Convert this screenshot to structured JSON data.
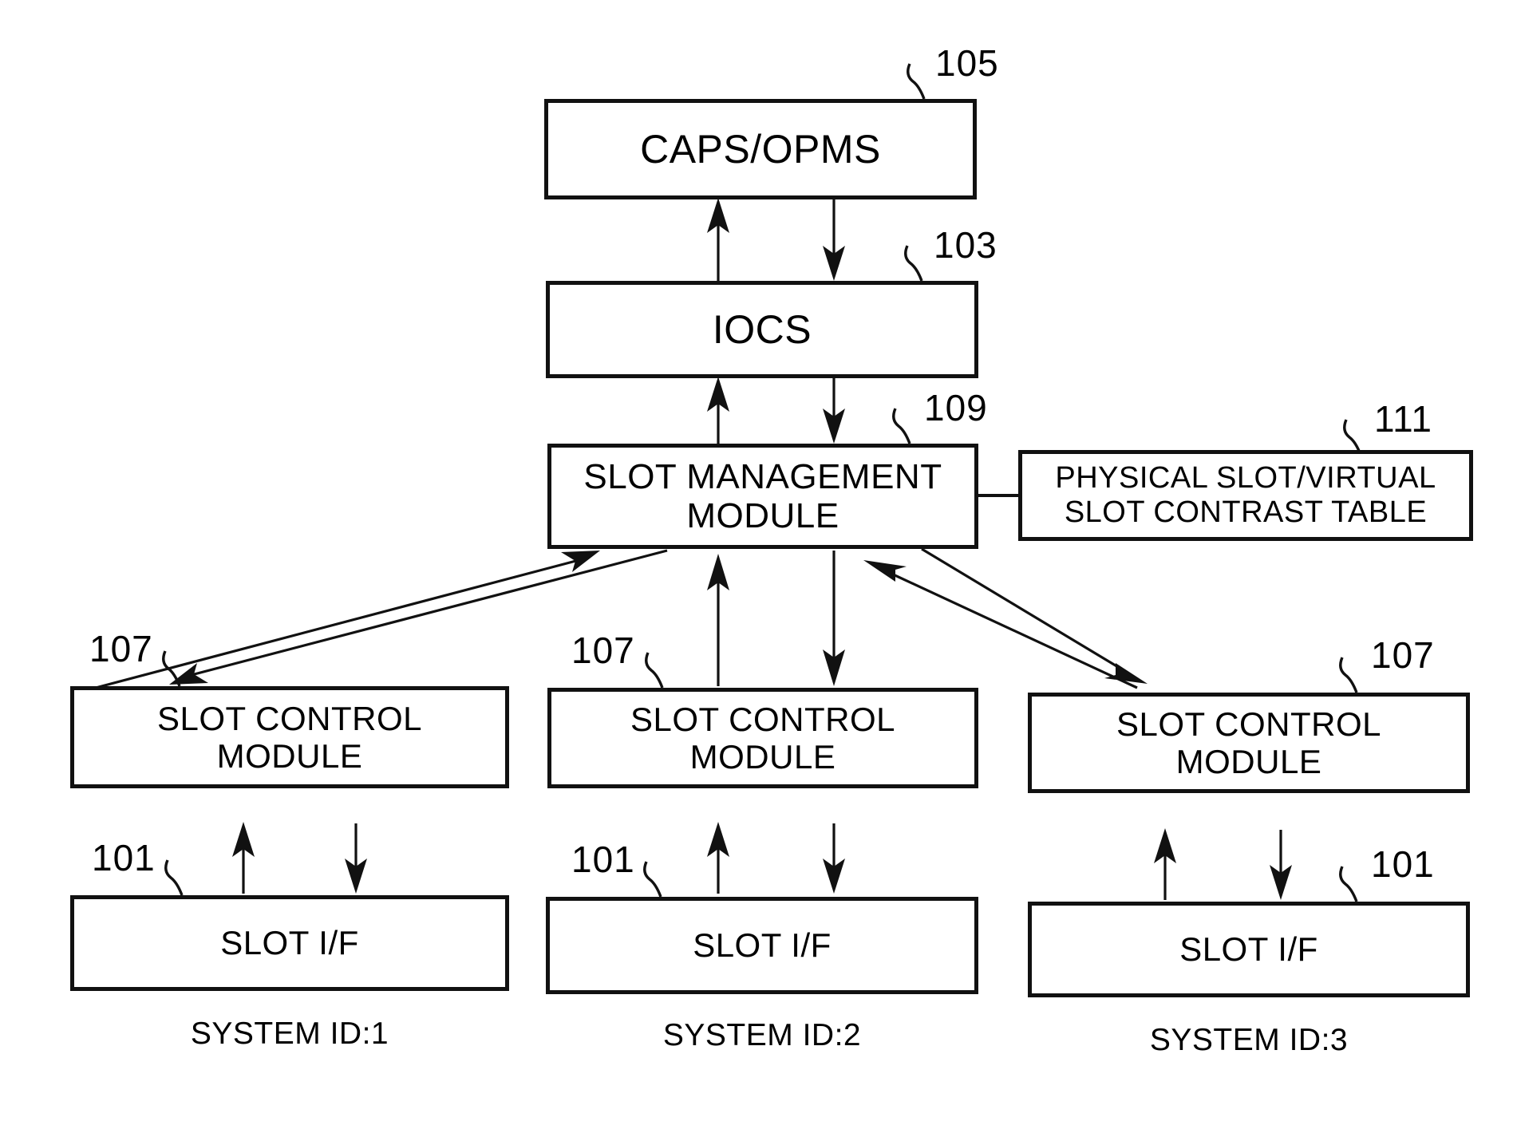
{
  "figure": {
    "type": "block-diagram",
    "background_color": "#ffffff",
    "line_color": "#111111"
  },
  "nodes": {
    "caps_opms": {
      "label": "CAPS/OPMS",
      "ref": "105"
    },
    "iocs": {
      "label": "IOCS",
      "ref": "103"
    },
    "slot_management_module": {
      "label": "SLOT MANAGEMENT\nMODULE",
      "ref": "109"
    },
    "contrast_table": {
      "label": "PHYSICAL SLOT/VIRTUAL\nSLOT CONTRAST TABLE",
      "ref": "111"
    },
    "slot_control_module_1": {
      "label": "SLOT CONTROL\nMODULE",
      "ref": "107"
    },
    "slot_control_module_2": {
      "label": "SLOT CONTROL\nMODULE",
      "ref": "107"
    },
    "slot_control_module_3": {
      "label": "SLOT CONTROL\nMODULE",
      "ref": "107"
    },
    "slot_if_1": {
      "label": "SLOT I/F",
      "ref": "101"
    },
    "slot_if_2": {
      "label": "SLOT I/F",
      "ref": "101"
    },
    "slot_if_3": {
      "label": "SLOT I/F",
      "ref": "101"
    }
  },
  "captions": {
    "system_1": "SYSTEM ID:1",
    "system_2": "SYSTEM ID:2",
    "system_3": "SYSTEM ID:3"
  }
}
